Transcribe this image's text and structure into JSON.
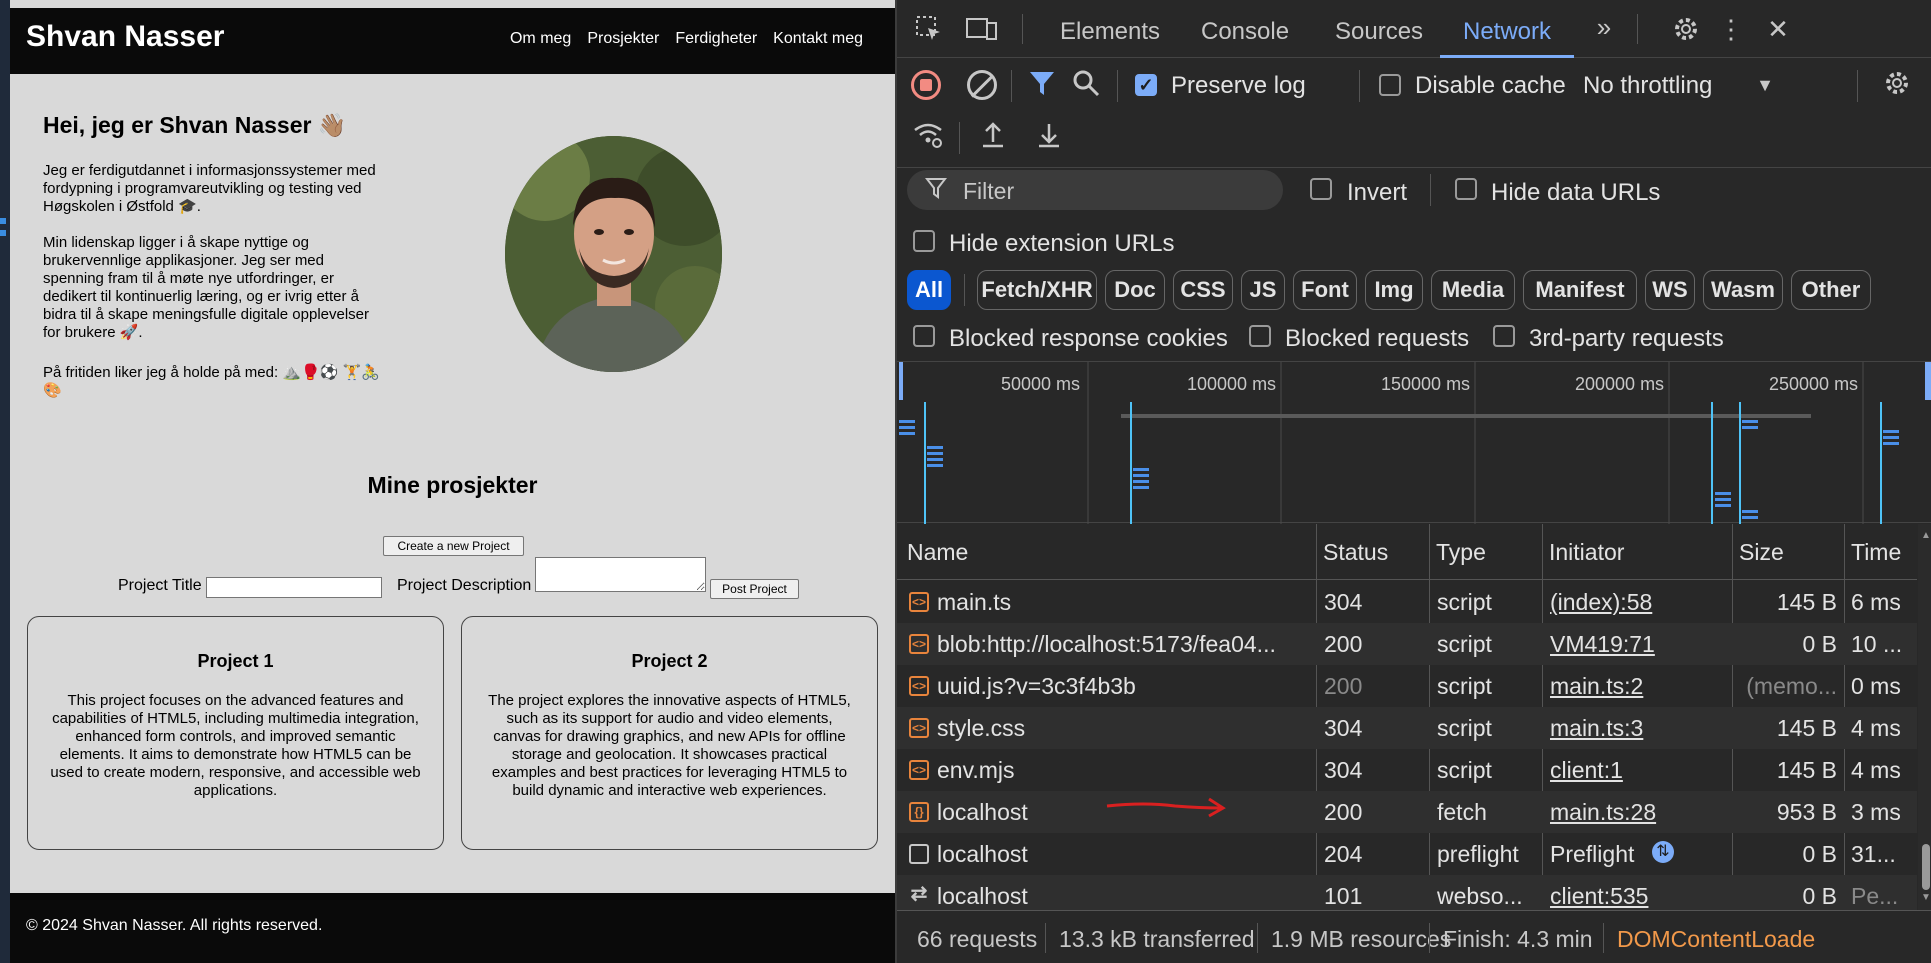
{
  "site": {
    "title": "Shvan Nasser",
    "nav": [
      "Om meg",
      "Prosjekter",
      "Ferdigheter",
      "Kontakt meg"
    ],
    "intro_heading": "Hei, jeg er Shvan Nasser 👋🏽",
    "intro_p1": "Jeg er ferdigutdannet i informasjonssystemer med fordypning i programvareutvikling og testing ved Høgskolen i Østfold 🎓.",
    "intro_p2": "Min lidenskap ligger i å skape nyttige og brukervennlige applikasjoner. Jeg ser med spenning fram til å møte nye utfordringer, er dedikert til kontinuerlig læring, og er ivrig etter å bidra til å skape meningsfulle digitale opplevelser for brukere 🚀.",
    "intro_p3": "På fritiden liker jeg å holde på med: ⛰️🥊⚽ 🏋️🚴🎨",
    "projects_heading": "Mine prosjekter",
    "create_button": "Create a new Project",
    "label_title": "Project Title",
    "label_description": "Project Description",
    "post_button": "Post Project",
    "projects": [
      {
        "title": "Project 1",
        "description": "This project focuses on the advanced features and capabilities of HTML5, including multimedia integration, enhanced form controls, and improved semantic elements. It aims to demonstrate how HTML5 can be used to create modern, responsive, and accessible web applications."
      },
      {
        "title": "Project 2",
        "description": "The project explores the innovative aspects of HTML5, such as its support for audio and video elements, canvas for drawing graphics, and new APIs for offline storage and geolocation. It showcases practical examples and best practices for leveraging HTML5 to build dynamic and interactive web experiences."
      }
    ],
    "footer": "© 2024 Shvan Nasser. All rights reserved."
  },
  "devtools": {
    "tabs": [
      "Elements",
      "Console",
      "Sources",
      "Network"
    ],
    "active_tab": "Network",
    "toolbar": {
      "preserve_log": "Preserve log",
      "disable_cache": "Disable cache",
      "throttling": "No throttling"
    },
    "filter": {
      "placeholder": "Filter",
      "invert": "Invert",
      "hide_data_urls": "Hide data URLs",
      "hide_extension_urls": "Hide extension URLs"
    },
    "type_filters": [
      "All",
      "Fetch/XHR",
      "Doc",
      "CSS",
      "JS",
      "Font",
      "Img",
      "Media",
      "Manifest",
      "WS",
      "Wasm",
      "Other"
    ],
    "extra_filters": {
      "blocked_cookies": "Blocked response cookies",
      "blocked_requests": "Blocked requests",
      "third_party": "3rd-party requests"
    },
    "timeline_ticks": [
      "50000 ms",
      "100000 ms",
      "150000 ms",
      "200000 ms",
      "250000 ms"
    ],
    "columns": [
      "Name",
      "Status",
      "Type",
      "Initiator",
      "Size",
      "Time"
    ],
    "rows": [
      {
        "name": "main.ts",
        "status": "304",
        "type": "script",
        "initiator": "(index):58",
        "size": "145 B",
        "time": "6 ms",
        "icon": "script-icon"
      },
      {
        "name": "blob:http://localhost:5173/fea04...",
        "status": "200",
        "type": "script",
        "initiator": "VM419:71",
        "size": "0 B",
        "time": "10 ...",
        "icon": "script-icon"
      },
      {
        "name": "uuid.js?v=3c3f4b3b",
        "status": "200",
        "type": "script",
        "initiator": "main.ts:2",
        "size": "(memo...",
        "time": "0 ms",
        "icon": "script-icon"
      },
      {
        "name": "style.css",
        "status": "304",
        "type": "script",
        "initiator": "main.ts:3",
        "size": "145 B",
        "time": "4 ms",
        "icon": "script-icon"
      },
      {
        "name": "env.mjs",
        "status": "304",
        "type": "script",
        "initiator": "client:1",
        "size": "145 B",
        "time": "4 ms",
        "icon": "script-icon"
      },
      {
        "name": "localhost",
        "status": "200",
        "type": "fetch",
        "initiator": "main.ts:28",
        "size": "953 B",
        "time": "3 ms",
        "icon": "fetch-icon"
      },
      {
        "name": "localhost",
        "status": "204",
        "type": "preflight",
        "initiator": "Preflight",
        "size": "0 B",
        "time": "31...",
        "icon": "preflight-icon"
      },
      {
        "name": "localhost",
        "status": "101",
        "type": "webso...",
        "initiator": "client:535",
        "size": "0 B",
        "time": "Pe...",
        "icon": "websocket-icon"
      }
    ],
    "status_bar": {
      "requests": "66 requests",
      "transferred": "13.3 kB transferred",
      "resources": "1.9 MB resources",
      "finish": "Finish: 4.3 min",
      "dom_loaded": "DOMContentLoade"
    },
    "colors": {
      "accent": "#7cacf8",
      "active_filter": "#0b57d0",
      "record": "#f28b82",
      "dom_loaded": "#f2994a",
      "annotation_arrow": "#d92020"
    }
  }
}
